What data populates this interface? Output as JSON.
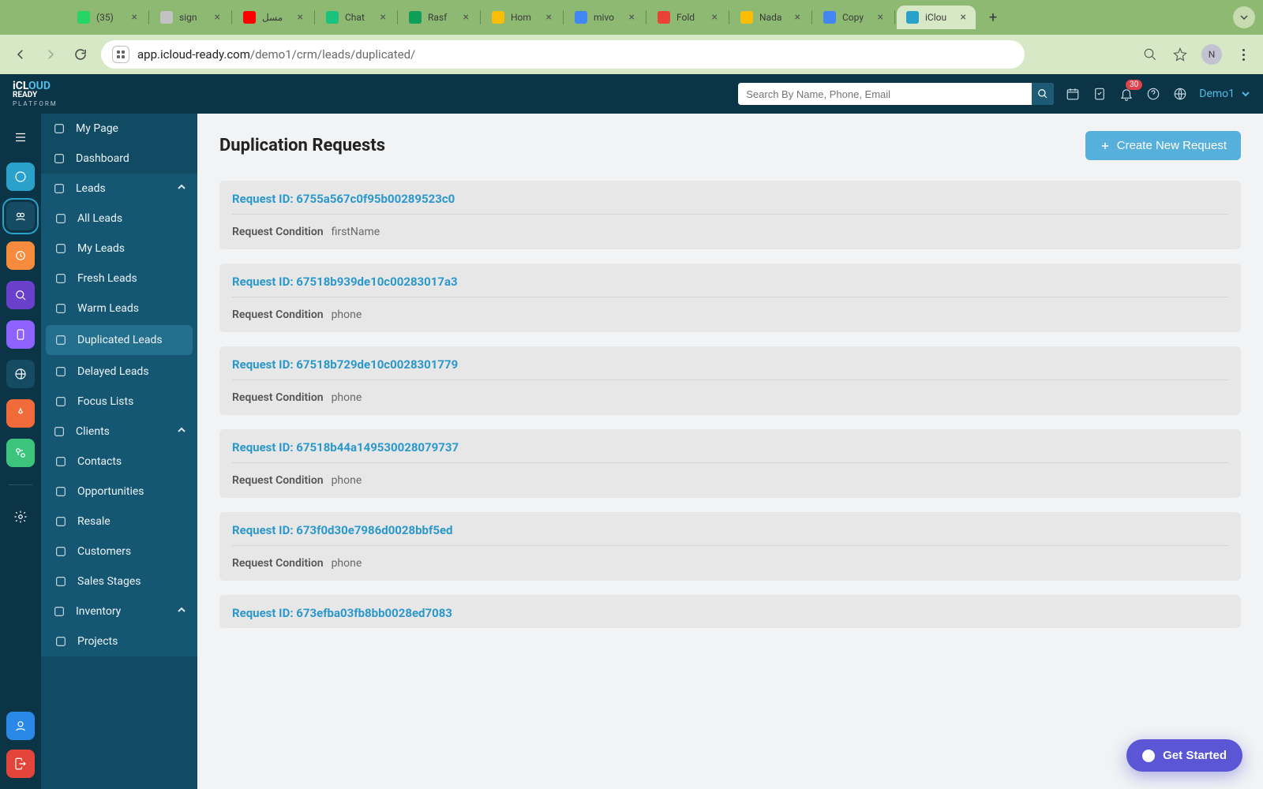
{
  "browser": {
    "tabs": [
      {
        "label": "(35)",
        "fav": "#25d366"
      },
      {
        "label": "sign",
        "fav": "#c2c2c2"
      },
      {
        "label": "مسل",
        "fav": "#ff0000"
      },
      {
        "label": "Chat",
        "fav": "#19c37d"
      },
      {
        "label": "Rasf",
        "fav": "#0f9d58"
      },
      {
        "label": "Hom",
        "fav": "#fbbc04"
      },
      {
        "label": "mivo",
        "fav": "#4285f4"
      },
      {
        "label": "Fold",
        "fav": "#ea4335"
      },
      {
        "label": "Nada",
        "fav": "#fbbc04"
      },
      {
        "label": "Copy",
        "fav": "#4285f4"
      },
      {
        "label": "iClou",
        "fav": "#2aa1c9",
        "active": true
      }
    ],
    "url_host": "app.icloud-ready.com",
    "url_path": "/demo1/crm/leads/duplicated/",
    "profile_initial": "N"
  },
  "app": {
    "logo": {
      "brand1": "iCL",
      "brand2": "OUD",
      "brand3": "READY",
      "sub": "PLATFORM"
    },
    "search_placeholder": "Search By Name, Phone, Email",
    "notif_count": "30",
    "org_name": "Demo1"
  },
  "sidebar": {
    "top": [
      {
        "label": "My Page",
        "icon": "page"
      },
      {
        "label": "Dashboard",
        "icon": "grid"
      }
    ],
    "leads_label": "Leads",
    "leads_items": [
      {
        "label": "All Leads",
        "icon": "users"
      },
      {
        "label": "My Leads",
        "icon": "user"
      },
      {
        "label": "Fresh Leads",
        "icon": "spark"
      },
      {
        "label": "Warm Leads",
        "icon": "flame"
      },
      {
        "label": "Duplicated Leads",
        "icon": "dup",
        "active": true
      },
      {
        "label": "Delayed Leads",
        "icon": "clock"
      },
      {
        "label": "Focus Lists",
        "icon": "list"
      }
    ],
    "clients_label": "Clients",
    "post_items": [
      {
        "label": "Contacts",
        "icon": "users"
      },
      {
        "label": "Opportunities",
        "icon": "target"
      },
      {
        "label": "Resale",
        "icon": "home"
      },
      {
        "label": "Customers",
        "icon": "smile"
      },
      {
        "label": "Sales Stages",
        "icon": "check"
      }
    ],
    "inventory_label": "Inventory",
    "inventory_items": [
      {
        "label": "Projects",
        "icon": "doc"
      }
    ]
  },
  "page": {
    "title": "Duplication Requests",
    "create_btn": "Create New Request",
    "cond_label": "Request Condition",
    "id_prefix": "Request ID: ",
    "requests": [
      {
        "id": "6755a567c0f95b00289523c0",
        "cond": "firstName"
      },
      {
        "id": "67518b939de10c00283017a3",
        "cond": "phone"
      },
      {
        "id": "67518b729de10c0028301779",
        "cond": "phone"
      },
      {
        "id": "67518b44a149530028079737",
        "cond": "phone"
      },
      {
        "id": "673f0d30e7986d0028bbf5ed",
        "cond": "phone"
      },
      {
        "id": "673efba03fb8bb0028ed7083",
        "cond": ""
      }
    ]
  },
  "getstarted": "Get Started"
}
